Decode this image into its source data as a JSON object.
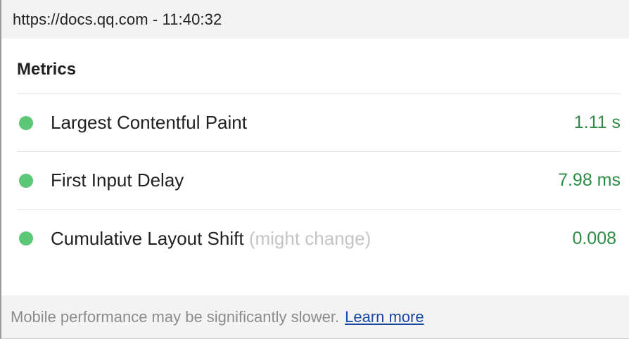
{
  "header": {
    "url_time": "https://docs.qq.com - 11:40:32"
  },
  "metrics": {
    "title": "Metrics",
    "items": [
      {
        "name": "Largest Contentful Paint",
        "note": "",
        "value": "1.11 s",
        "status": "good"
      },
      {
        "name": "First Input Delay",
        "note": "",
        "value": "7.98 ms",
        "status": "good"
      },
      {
        "name": "Cumulative Layout Shift",
        "note": "(might change)",
        "value": "0.008",
        "status": "good"
      }
    ]
  },
  "footer": {
    "notice": "Mobile performance may be significantly slower.",
    "link_label": "Learn more"
  },
  "colors": {
    "good_dot": "#5cc776",
    "good_value": "#2e8b47",
    "link": "#1a4aa1"
  }
}
